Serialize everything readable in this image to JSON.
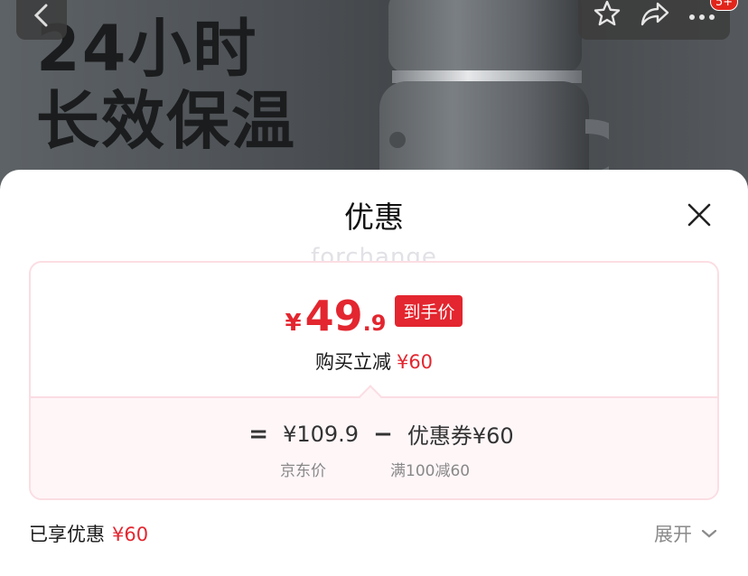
{
  "hero": {
    "line1": "24小时",
    "line2": "长效保温"
  },
  "nav": {
    "badge": "5+"
  },
  "sheet": {
    "title": "优惠",
    "watermark": "forchange"
  },
  "price": {
    "currency": "¥",
    "integer": "49",
    "decimal": ".9",
    "tag": "到手价",
    "reduce_label": "购买立减",
    "reduce_amount": "¥60"
  },
  "formula": {
    "equals": "=",
    "base_price": "¥109.9",
    "base_label": "京东价",
    "minus": "−",
    "coupon": "优惠券¥60",
    "coupon_label": "满100减60"
  },
  "footer": {
    "enjoyed_label": "已享优惠",
    "enjoyed_amount": "¥60",
    "expand_label": "展开"
  },
  "colors": {
    "accent": "#e3262f",
    "card_border": "#fbdde3",
    "card_bottom_bg": "#fff6f8"
  }
}
